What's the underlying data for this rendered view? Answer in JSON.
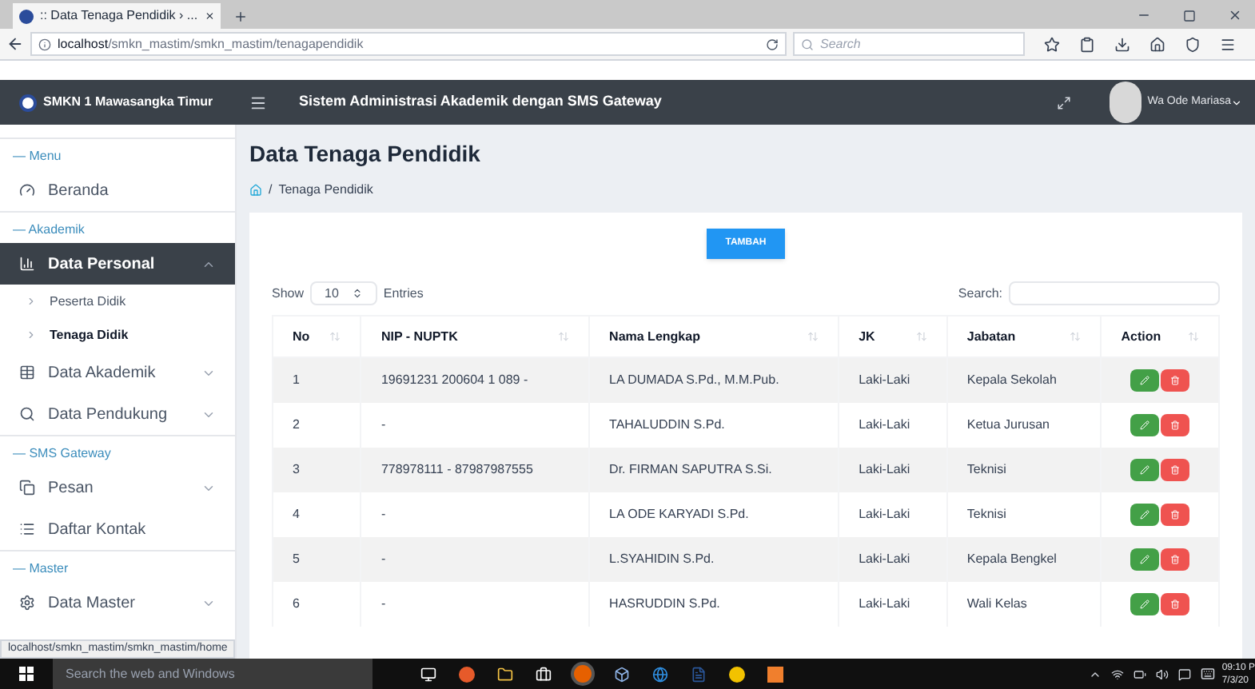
{
  "browser": {
    "tab_title": ":: Data Tenaga Pendidik › ...",
    "url_host": "localhost",
    "url_path": "/smkn_mastim/smkn_mastim/tenagapendidik",
    "search_placeholder": "Search",
    "status_url": "localhost/smkn_mastim/smkn_mastim/home"
  },
  "header": {
    "brand": "SMKN 1 Mawasangka Timur",
    "title": "Sistem Administrasi Akademik dengan SMS Gateway",
    "user": "Wa Ode Mariasa"
  },
  "sidebar": {
    "items": [
      {
        "kind": "section",
        "label": "— Menu"
      },
      {
        "kind": "link",
        "label": "Beranda"
      },
      {
        "kind": "section",
        "label": "— Akademik"
      },
      {
        "kind": "group",
        "label": "Data Personal",
        "expanded": true,
        "children": [
          {
            "label": "Peserta Didik",
            "selected": false
          },
          {
            "label": "Tenaga Didik",
            "selected": true
          }
        ]
      },
      {
        "kind": "group",
        "label": "Data Akademik",
        "expanded": false
      },
      {
        "kind": "group",
        "label": "Data Pendukung",
        "expanded": false
      },
      {
        "kind": "section",
        "label": "— SMS Gateway"
      },
      {
        "kind": "group",
        "label": "Pesan",
        "expanded": false
      },
      {
        "kind": "link",
        "label": "Daftar Kontak"
      },
      {
        "kind": "section",
        "label": "— Master"
      },
      {
        "kind": "group",
        "label": "Data Master",
        "expanded": false
      }
    ]
  },
  "page": {
    "title": "Data Tenaga Pendidik",
    "breadcrumb_separator": "/",
    "breadcrumb": "Tenaga Pendidik",
    "add_button": "TAMBAH",
    "show_label": "Show",
    "page_size": "10",
    "entries_label": "Entries",
    "search_label": "Search:"
  },
  "table": {
    "columns": [
      "No",
      "NIP - NUPTK",
      "Nama Lengkap",
      "JK",
      "Jabatan",
      "Action"
    ],
    "rows": [
      [
        "1",
        "19691231 200604 1 089 -",
        "LA DUMADA S.Pd., M.M.Pub.",
        "Laki-Laki",
        "Kepala Sekolah"
      ],
      [
        "2",
        "-",
        "TAHALUDDIN S.Pd.",
        "Laki-Laki",
        "Ketua Jurusan"
      ],
      [
        "3",
        "778978111 - 87987987555",
        "Dr. FIRMAN SAPUTRA S.Si.",
        "Laki-Laki",
        "Teknisi"
      ],
      [
        "4",
        "-",
        "LA ODE KARYADI S.Pd.",
        "Laki-Laki",
        "Teknisi"
      ],
      [
        "5",
        "-",
        "L.SYAHIDIN S.Pd.",
        "Laki-Laki",
        "Kepala Bengkel"
      ],
      [
        "6",
        "-",
        "HASRUDDIN S.Pd.",
        "Laki-Laki",
        "Wali Kelas"
      ]
    ]
  },
  "taskbar": {
    "search_placeholder": "Search the web and Windows",
    "time": "09:10 P",
    "date": "7/3/20"
  }
}
